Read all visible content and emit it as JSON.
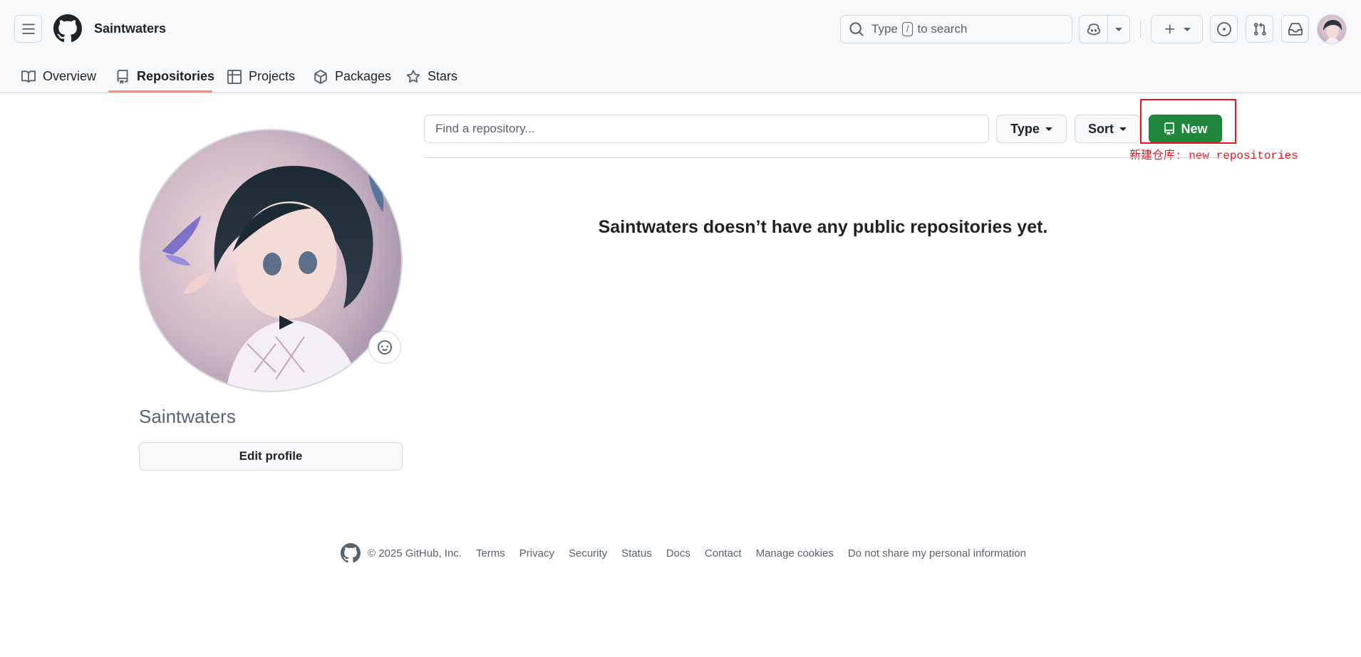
{
  "header": {
    "username": "Saintwaters",
    "search": {
      "prefix": "Type",
      "key": "/",
      "suffix": "to search"
    }
  },
  "tabs": [
    {
      "label": "Overview",
      "icon": "book-icon",
      "active": false
    },
    {
      "label": "Repositories",
      "icon": "repo-icon",
      "active": true
    },
    {
      "label": "Projects",
      "icon": "table-icon",
      "active": false
    },
    {
      "label": "Packages",
      "icon": "package-icon",
      "active": false
    },
    {
      "label": "Stars",
      "icon": "star-icon",
      "active": false
    }
  ],
  "profile": {
    "name": "Saintwaters",
    "edit_label": "Edit profile"
  },
  "repos": {
    "find_placeholder": "Find a repository...",
    "type_label": "Type",
    "sort_label": "Sort",
    "new_label": "New",
    "empty_message": "Saintwaters doesn’t have any public repositories yet."
  },
  "annotation": {
    "text": "新建仓库: new repositories",
    "color": "#e8131b"
  },
  "footer": {
    "copyright": "© 2025 GitHub, Inc.",
    "links": [
      "Terms",
      "Privacy",
      "Security",
      "Status",
      "Docs",
      "Contact",
      "Manage cookies",
      "Do not share my personal information"
    ]
  },
  "colors": {
    "accent_green": "#1f883d",
    "tab_underline": "#fd8c73",
    "header_bg": "#f6f8fa"
  }
}
